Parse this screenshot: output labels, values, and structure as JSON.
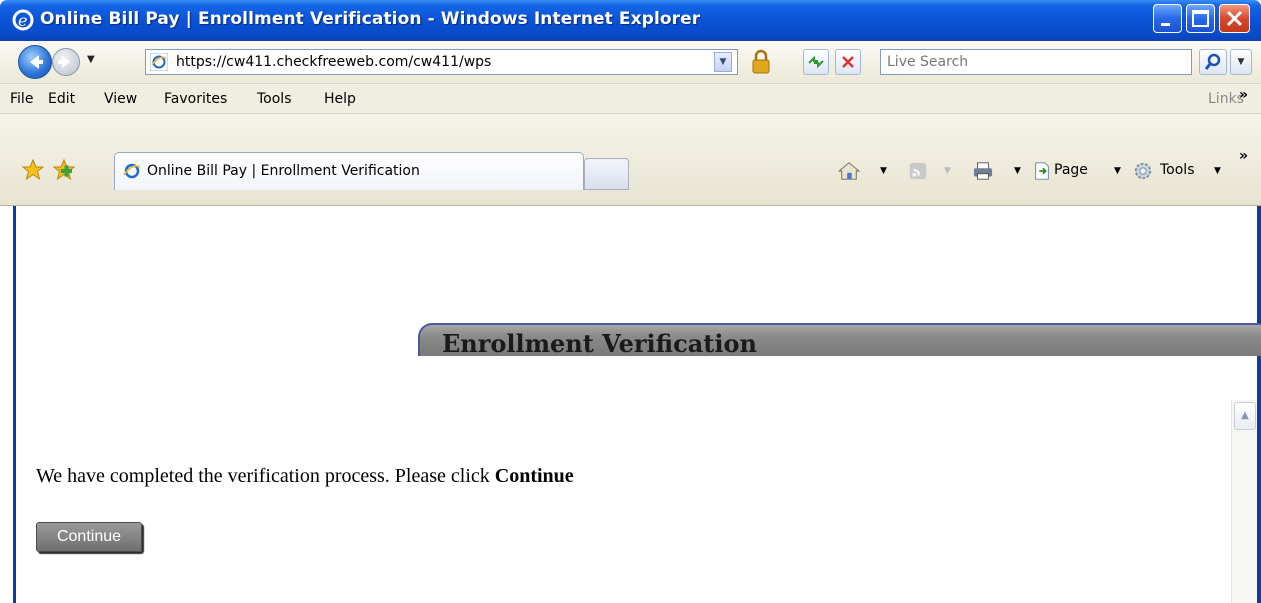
{
  "window": {
    "title": "Online Bill Pay | Enrollment Verification - Windows Internet Explorer"
  },
  "address_bar": {
    "url": "https://cw411.checkfreeweb.com/cw411/wps",
    "search_placeholder": "Live Search"
  },
  "menu": {
    "items": [
      "File",
      "Edit",
      "View",
      "Favorites",
      "Tools",
      "Help"
    ],
    "links_label": "Links",
    "chevron": "»"
  },
  "tabs": {
    "active_label": "Online Bill Pay | Enrollment Verification"
  },
  "command_bar": {
    "page_label": "Page",
    "tools_label": "Tools",
    "chevron": "»"
  },
  "page": {
    "section_title": "Enrollment Verification",
    "message_prefix": "We have completed the verification process. Please click ",
    "message_emphasis": "Continue",
    "continue_button": "Continue"
  },
  "colors": {
    "titlebar_blue": "#0a52d6",
    "header_gray": "#8b8b8b",
    "button_gray": "#7f7f7f"
  },
  "icons": [
    "ie-icon",
    "back-icon",
    "forward-icon",
    "lock-icon",
    "refresh-icon",
    "stop-icon",
    "search-icon",
    "favorites-star-icon",
    "add-favorite-icon",
    "home-icon",
    "feed-icon",
    "print-icon",
    "page-icon",
    "tools-gear-icon",
    "minimize-icon",
    "maximize-icon",
    "close-icon",
    "scroll-up-icon"
  ]
}
